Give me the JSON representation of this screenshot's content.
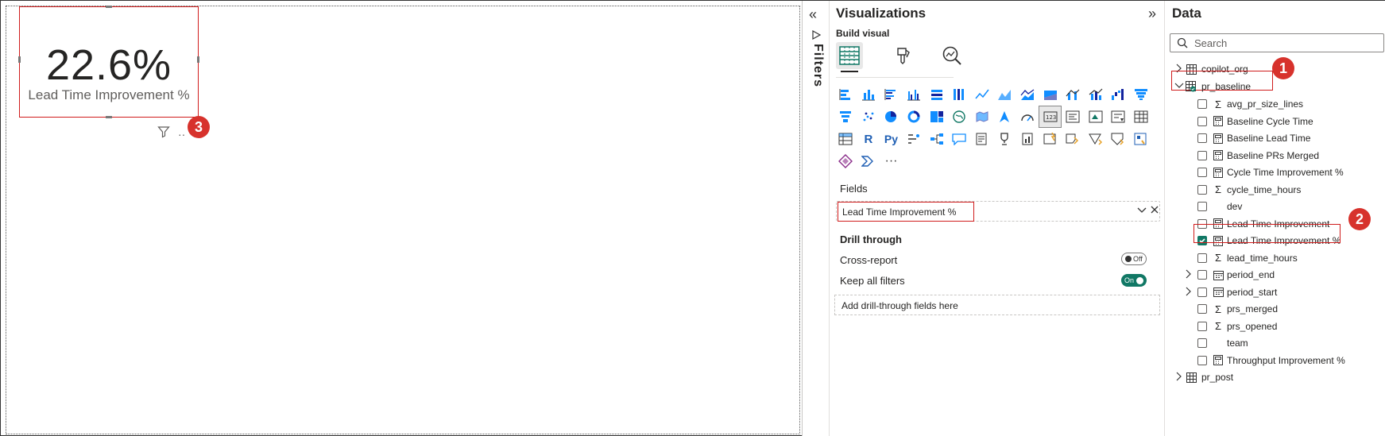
{
  "card": {
    "value": "22.6%",
    "label": "Lead Time Improvement %"
  },
  "badges": {
    "one": "1",
    "two": "2",
    "three": "3"
  },
  "filters_pane": {
    "label": "Filters",
    "collapse_icon": "double-chevron-left"
  },
  "visualizations": {
    "title": "Visualizations",
    "expand_icon": "double-chevron-right",
    "build_visual_label": "Build visual",
    "more_label": "···",
    "fields_label": "Fields",
    "field_value": "Lead Time Improvement %",
    "drill_through_label": "Drill through",
    "cross_report_label": "Cross-report",
    "cross_report_state": "Off",
    "keep_filters_label": "Keep all filters",
    "keep_filters_state": "On",
    "add_drill_placeholder": "Add drill-through fields here"
  },
  "data_pane": {
    "title": "Data",
    "search_placeholder": "Search",
    "tables": [
      {
        "name": "copilot_org"
      },
      {
        "name": "pr_baseline"
      },
      {
        "name": "pr_post"
      }
    ],
    "fields": [
      {
        "name": "avg_pr_size_lines",
        "icon": "sigma",
        "checked": false
      },
      {
        "name": "Baseline Cycle Time",
        "icon": "calculator",
        "checked": false
      },
      {
        "name": "Baseline Lead Time",
        "icon": "calculator",
        "checked": false
      },
      {
        "name": "Baseline PRs Merged",
        "icon": "calculator",
        "checked": false
      },
      {
        "name": "Cycle Time Improvement %",
        "icon": "calculator",
        "checked": false
      },
      {
        "name": "cycle_time_hours",
        "icon": "sigma",
        "checked": false
      },
      {
        "name": "dev",
        "icon": "none",
        "checked": false
      },
      {
        "name": "Lead Time Improvement",
        "icon": "calculator",
        "checked": false
      },
      {
        "name": "Lead Time Improvement %",
        "icon": "calculator",
        "checked": true
      },
      {
        "name": "lead_time_hours",
        "icon": "sigma",
        "checked": false
      },
      {
        "name": "period_end",
        "icon": "calendar",
        "checked": false
      },
      {
        "name": "period_start",
        "icon": "calendar",
        "checked": false
      },
      {
        "name": "prs_merged",
        "icon": "sigma",
        "checked": false
      },
      {
        "name": "prs_opened",
        "icon": "sigma",
        "checked": false
      },
      {
        "name": "team",
        "icon": "none",
        "checked": false
      },
      {
        "name": "Throughput Improvement %",
        "icon": "calculator",
        "checked": false
      }
    ]
  },
  "colors": {
    "accent_red": "#d01c1c",
    "badge_red": "#d7322c",
    "toggle_on": "#117865"
  }
}
